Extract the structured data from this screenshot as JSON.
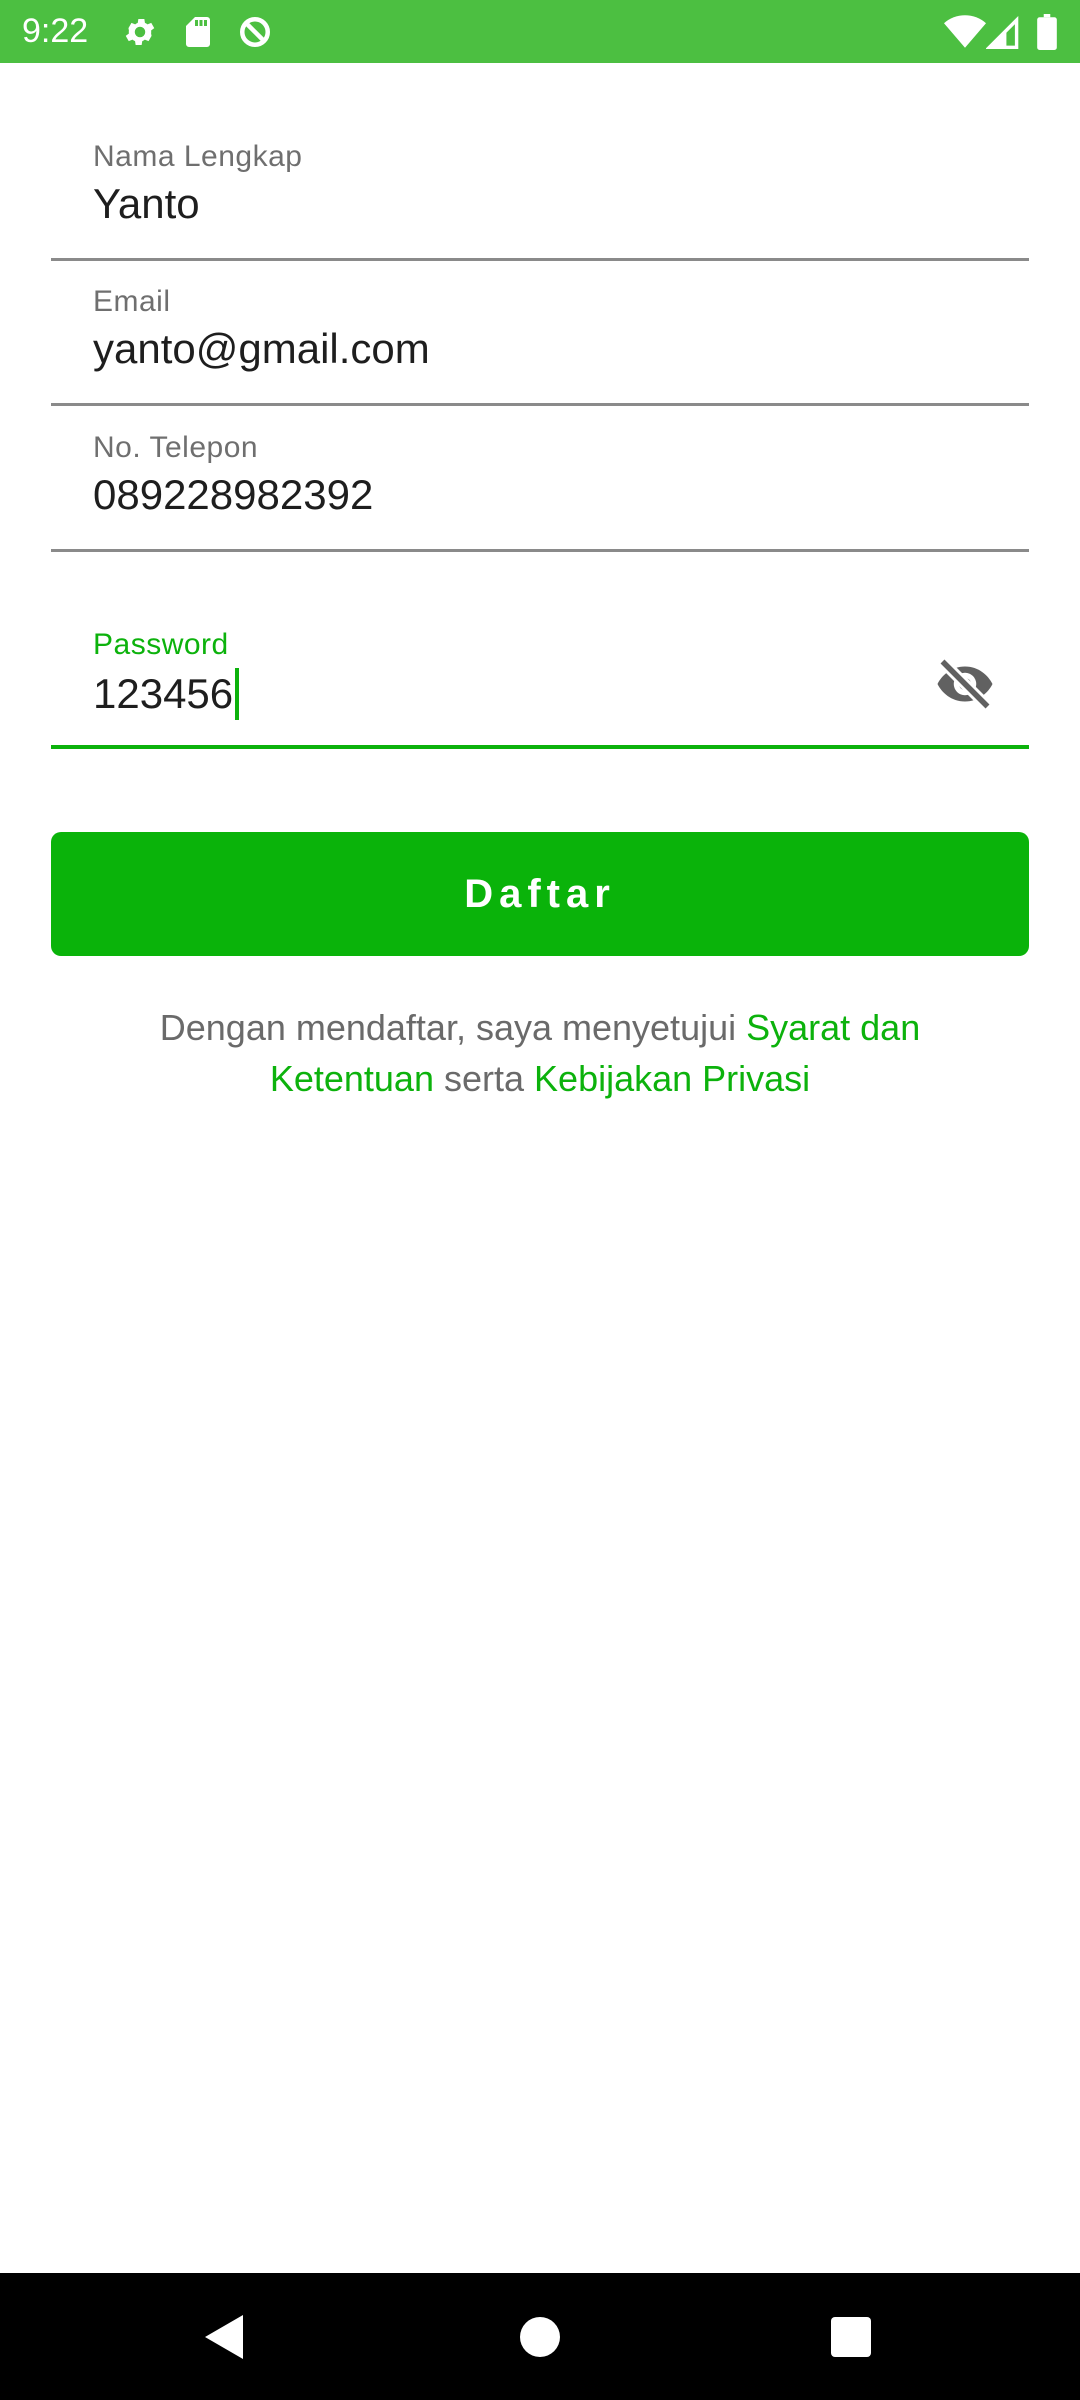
{
  "status_bar": {
    "time": "9:22",
    "icons_left": [
      "settings-icon",
      "sd-card-icon",
      "data-saver-icon"
    ],
    "icons_right": [
      "wifi-icon",
      "signal-icon",
      "battery-icon"
    ]
  },
  "form": {
    "full_name": {
      "label": "Nama Lengkap",
      "value": "Yanto"
    },
    "email": {
      "label": "Email",
      "value": "yanto@gmail.com"
    },
    "phone": {
      "label": "No. Telepon",
      "value": "089228982392"
    },
    "password": {
      "label": "Password",
      "value": "123456",
      "toggle_icon": "visibility-off-icon"
    }
  },
  "actions": {
    "register_label": "Daftar"
  },
  "terms": {
    "prefix": "Dengan mendaftar, saya menyetujui ",
    "terms_link": "Syarat dan Ketentuan",
    "middle": " serta ",
    "privacy_link": "Kebijakan Privasi"
  },
  "nav_bar": {
    "icons": [
      "back-icon",
      "home-icon",
      "recents-icon"
    ]
  },
  "colors": {
    "status_bar": "#4cbf41",
    "accent": "#0cb20c",
    "button": "#0ab30a",
    "text": "#1e1e1e",
    "label": "#6f6f6f"
  }
}
